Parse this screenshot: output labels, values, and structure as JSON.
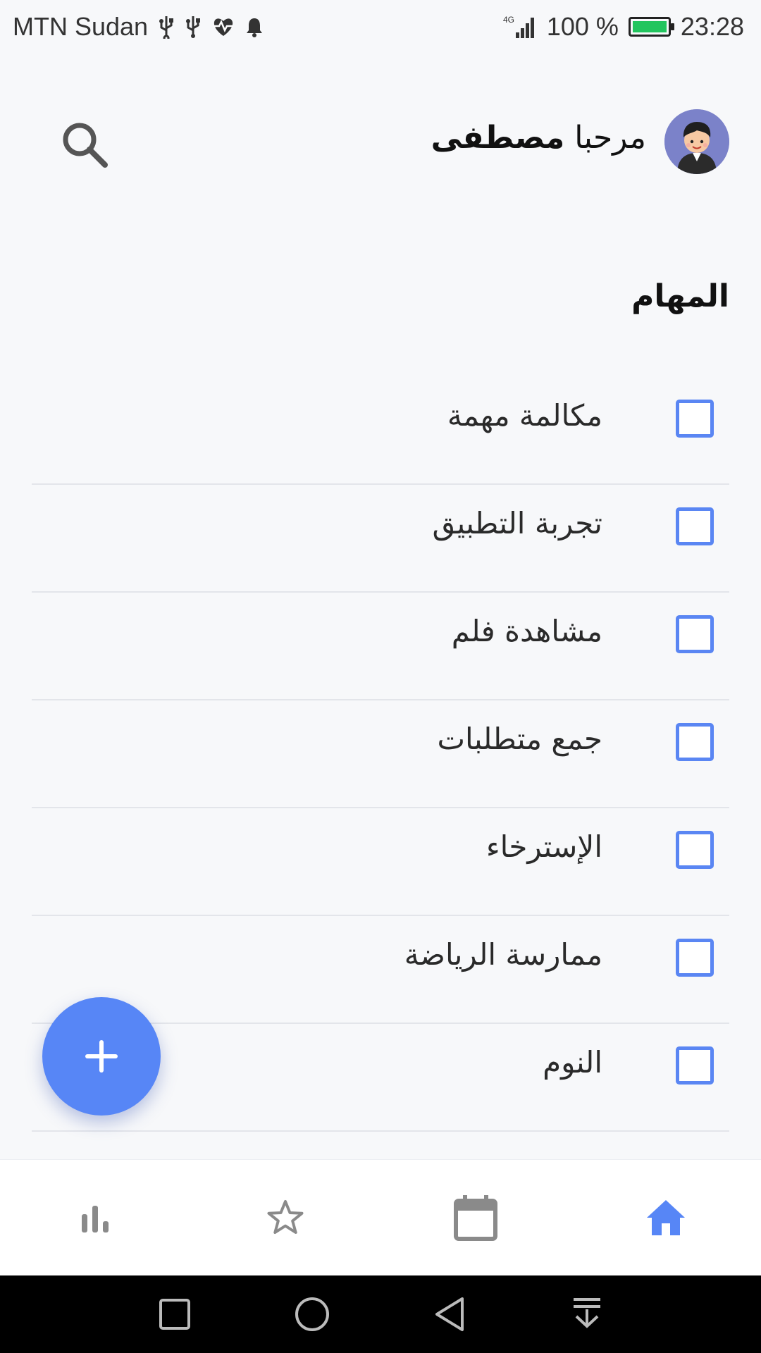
{
  "status_bar": {
    "carrier": "MTN Sudan",
    "network": "4G",
    "battery_percent": "100 %",
    "time": "23:28",
    "icons": [
      "usb-icon",
      "usb-icon",
      "heart-rate-icon",
      "bell-icon",
      "signal-icon",
      "battery-charging-icon"
    ]
  },
  "header": {
    "greeting": "مرحبا",
    "user_name": "مصطفى",
    "avatar_icon": "user-avatar",
    "search_icon": "search-icon"
  },
  "section": {
    "title": "المهام"
  },
  "tasks": [
    {
      "label": "مكالمة مهمة",
      "checked": false
    },
    {
      "label": "تجربة التطبيق",
      "checked": false
    },
    {
      "label": "مشاهدة فلم",
      "checked": false
    },
    {
      "label": "جمع متطلبات",
      "checked": false
    },
    {
      "label": "الإسترخاء",
      "checked": false
    },
    {
      "label": "ممارسة الرياضة",
      "checked": false
    },
    {
      "label": "النوم",
      "checked": false
    }
  ],
  "fab": {
    "icon": "plus-icon"
  },
  "bottom_nav": {
    "items": [
      {
        "icon": "bar-chart-icon",
        "active": false
      },
      {
        "icon": "star-icon",
        "active": false
      },
      {
        "icon": "calendar-icon",
        "active": false
      },
      {
        "icon": "home-icon",
        "active": true
      }
    ],
    "active_color": "#5786f6",
    "inactive_color": "#8a8a8a"
  },
  "colors": {
    "accent": "#5786f6",
    "checkbox_border": "#5a86f3",
    "background": "#f7f8fa"
  }
}
